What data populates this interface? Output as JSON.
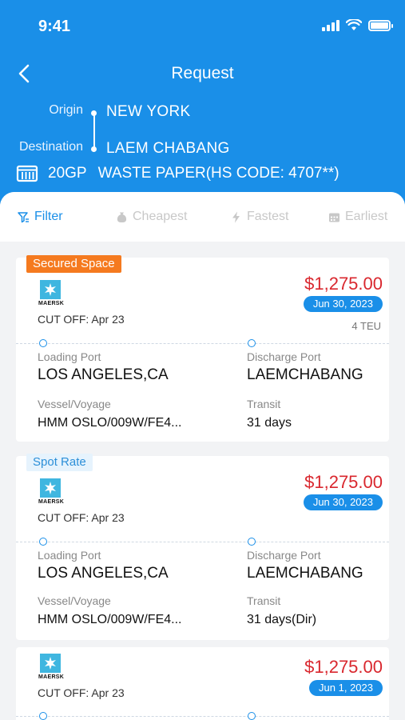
{
  "status": {
    "time": "9:41"
  },
  "nav": {
    "title": "Request"
  },
  "route": {
    "origin_label": "Origin",
    "origin_value": "NEW YORK",
    "destination_label": "Destination",
    "destination_value": "LAEM CHABANG"
  },
  "cargo": {
    "container": "20GP",
    "commodity": "WASTE PAPER(HS CODE: 4707**)"
  },
  "filters": [
    {
      "label": "Filter",
      "icon": "filter-icon"
    },
    {
      "label": "Cheapest",
      "icon": "money-bag-icon"
    },
    {
      "label": "Fastest",
      "icon": "lightning-icon"
    },
    {
      "label": "Earliest",
      "icon": "calendar-icon"
    }
  ],
  "colors": {
    "primary": "#1a8fe8",
    "price": "#d9272e",
    "secured_badge": "#f57a1f",
    "spot_badge": "#e6f3fd"
  },
  "cards": [
    {
      "badge": "Secured Space",
      "carrier": "MAERSK",
      "cutoff": "CUT OFF: Apr 23",
      "price": "$1,275.00",
      "date": "Jun 30, 2023",
      "teu": "4 TEU",
      "loading_label": "Loading Port",
      "loading_port": "LOS ANGELES,CA",
      "discharge_label": "Discharge Port",
      "discharge_port": "LAEMCHABANG",
      "vessel_label": "Vessel/Voyage",
      "vessel": "HMM OSLO/009W/FE4...",
      "transit_label": "Transit",
      "transit": "31 days"
    },
    {
      "badge": "Spot Rate",
      "carrier": "MAERSK",
      "cutoff": "CUT OFF: Apr 23",
      "price": "$1,275.00",
      "date": "Jun 30, 2023",
      "loading_label": "Loading Port",
      "loading_port": "LOS ANGELES,CA",
      "discharge_label": "Discharge Port",
      "discharge_port": "LAEMCHABANG",
      "vessel_label": "Vessel/Voyage",
      "vessel": "HMM OSLO/009W/FE4...",
      "transit_label": "Transit",
      "transit": "31 days(Dir)"
    },
    {
      "carrier": "MAERSK",
      "cutoff": "CUT OFF: Apr 23",
      "price": "$1,275.00",
      "date": "Jun 1, 2023"
    }
  ]
}
